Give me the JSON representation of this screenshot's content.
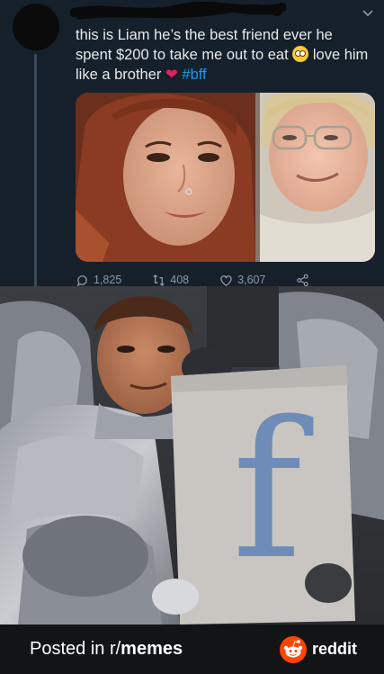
{
  "tweet": {
    "text_part1": "this is Liam he’s the best friend ever he spent $200 to take me out to eat",
    "text_part2": "love him like a brother",
    "hashtag": "#bff",
    "emoji_face": "rolling-eyes-emoji",
    "emoji_heart": "red-heart-emoji",
    "stats": {
      "replies": "1,825",
      "retweets": "408",
      "likes": "3,607"
    }
  },
  "meme": {
    "sign_letter": "f"
  },
  "footer": {
    "posted_prefix": "Posted in r/",
    "subreddit": "memes",
    "brand": "reddit"
  },
  "colors": {
    "tweet_bg": "#15202b",
    "text": "#e7e9ea",
    "hashtag": "#1d9bf0",
    "action_gray": "#8b98a5",
    "footer_bg": "#131416",
    "reddit_orange": "#ff4500"
  }
}
